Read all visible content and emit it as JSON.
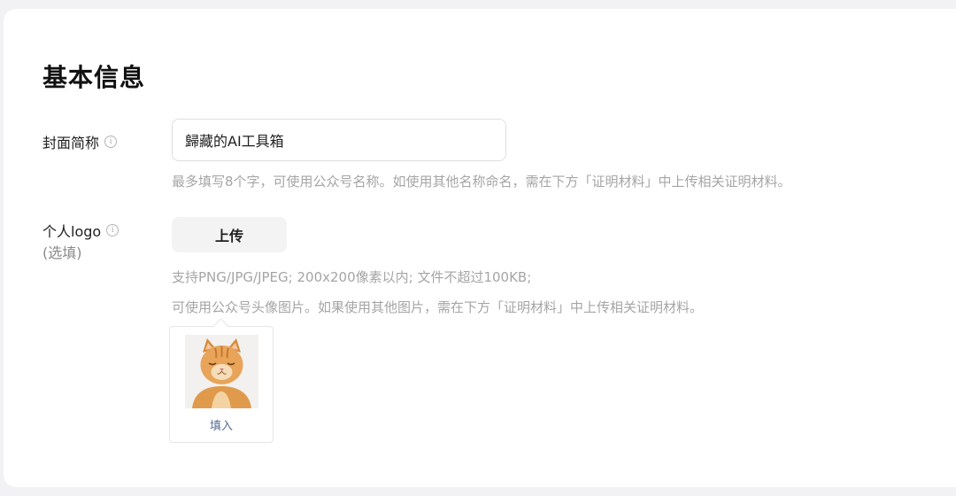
{
  "section": {
    "title": "基本信息"
  },
  "cover_name": {
    "label": "封面简称",
    "info_icon": "info-circle-icon",
    "value": "歸藏的AI工具箱",
    "hint": "最多填写8个字，可使用公众号名称。如使用其他名称命名，需在下方「证明材料」中上传相关证明材料。"
  },
  "personal_logo": {
    "label": "个人logo",
    "info_icon": "info-circle-icon",
    "optional_label": "(选填)",
    "upload_label": "上传",
    "hint_line1": "支持PNG/JPG/JPEG; 200x200像素以内; 文件不超过100KB;",
    "hint_line2": "可使用公众号头像图片。如果使用其他图片，需在下方「证明材料」中上传相关证明材料。"
  },
  "avatar_popover": {
    "image": "orange-tabby-cat-avatar",
    "fill_label": "填入"
  },
  "colors": {
    "link": "#576b95",
    "hint_text": "#a5a5a5",
    "card_bg": "#ffffff",
    "page_bg": "#f2f2f4"
  }
}
